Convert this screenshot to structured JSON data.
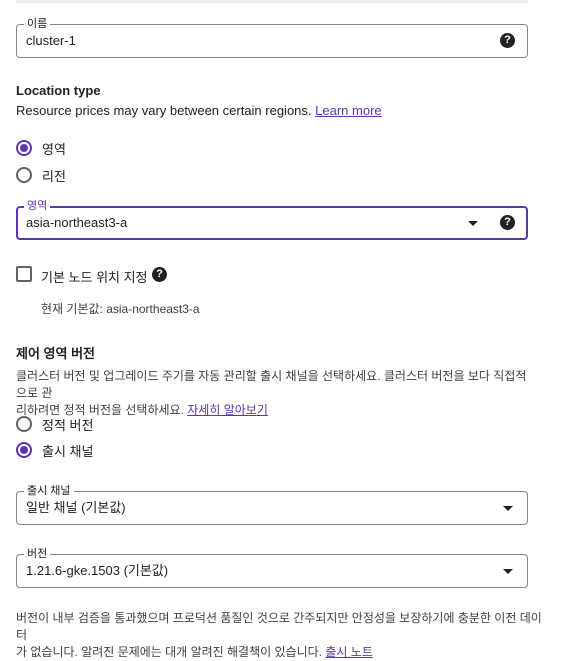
{
  "name_field": {
    "label": "이름",
    "value": "cluster-1",
    "help_icon": "help-icon"
  },
  "location": {
    "title": "Location type",
    "description": "Resource prices may vary between certain regions.",
    "learn_more": "Learn more",
    "options": [
      {
        "label": "영역",
        "selected": true
      },
      {
        "label": "리전",
        "selected": false
      }
    ]
  },
  "zone_select": {
    "label": "영역",
    "value": "asia-northeast3-a"
  },
  "default_node_locations": {
    "label": "기본 노드 위치 지정",
    "checked": false,
    "default_note": "현재 기본값: asia-northeast3-a"
  },
  "control_plane": {
    "title": "제어 영역 버전",
    "description_line1": "클러스터 버전 및 업그레이드 주기를 자동 관리할 출시 채널을 선택하세요. 클러스터 버전을 보다 직접적으로 관",
    "description_line2": "리하려면 정적 버전을 선택하세요.",
    "learn_more": "자세히 알아보기",
    "options": [
      {
        "label": "정적 버전",
        "selected": false
      },
      {
        "label": "출시 채널",
        "selected": true
      }
    ]
  },
  "release_channel_select": {
    "label": "출시 채널",
    "value": "일반 채널 (기본값)"
  },
  "version_select": {
    "label": "버전",
    "value": "1.21.6-gke.1503 (기본값)"
  },
  "footer": {
    "line1": "버전이 내부 검증을 통과했으며 프로덕션 품질인 것으로 간주되지만 안정성을 보장하기에 충분한 이전 데이터",
    "line2": "가 없습니다. 알려진 문제에는 대개 알려진 해결책이 있습니다.",
    "release_notes": "출시 노트"
  },
  "colors": {
    "accent": "#5e35b1",
    "text": "#202124",
    "border": "#80868b"
  }
}
